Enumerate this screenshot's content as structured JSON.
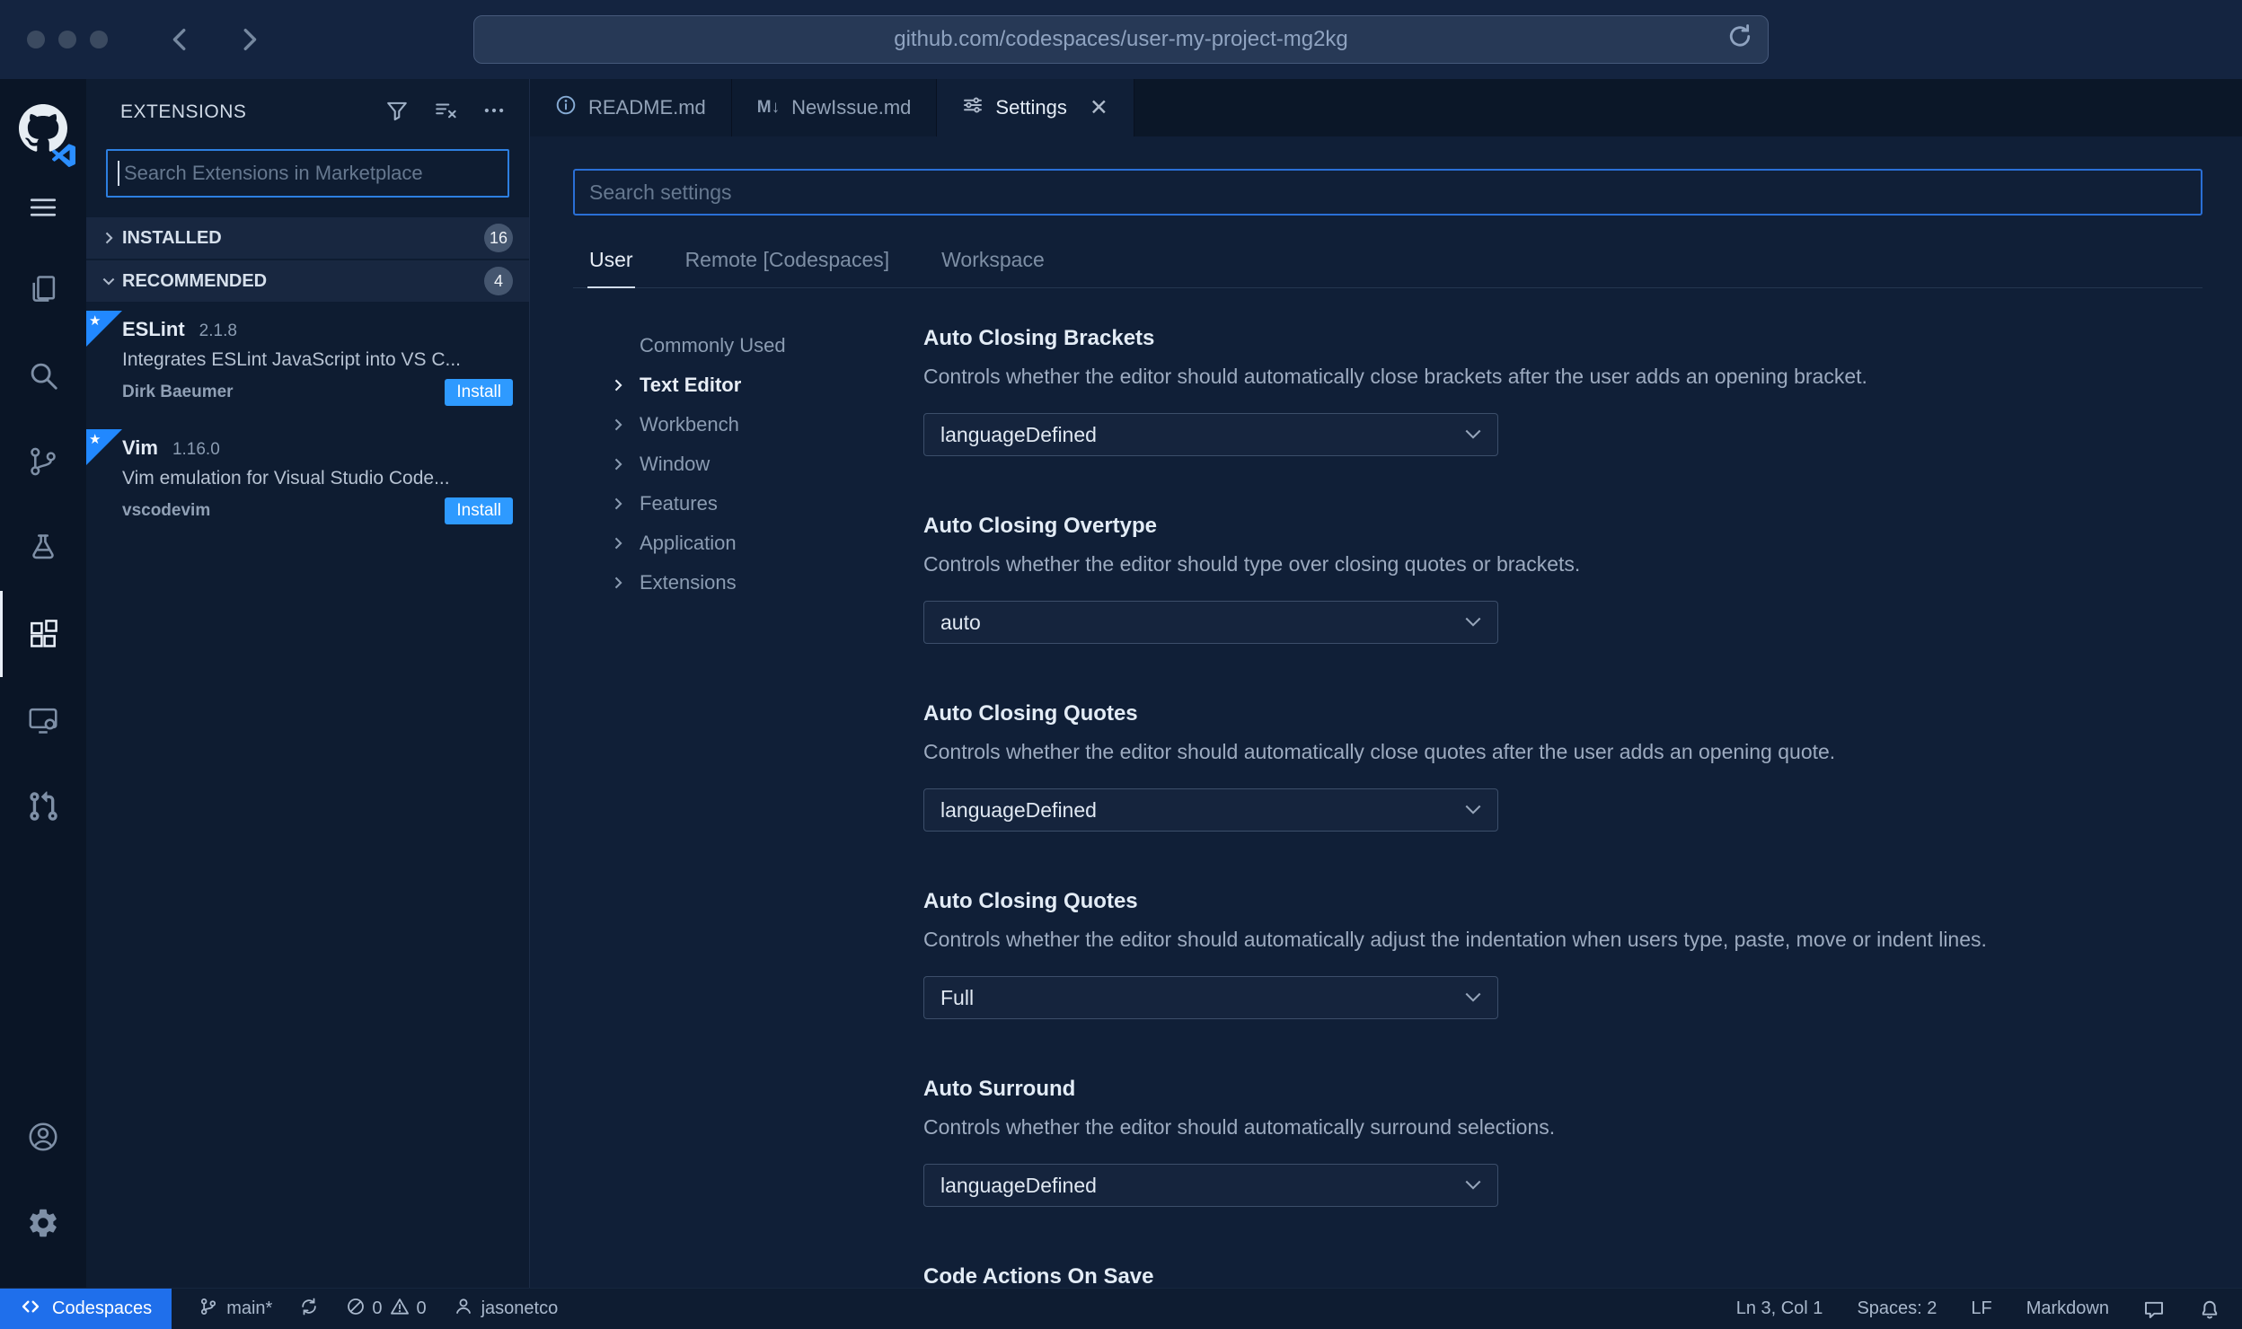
{
  "browser": {
    "url": "github.com/codespaces/user-my-project-mg2kg"
  },
  "icons": {
    "markdown_glyph": "M↓",
    "star": "★",
    "close": "✕"
  },
  "colors": {
    "accent": "#2188ff",
    "install_button": "#2e9aff",
    "codespaces_chip": "#1f6feb",
    "focus_border": "#2d7fe0"
  },
  "sidebar": {
    "title": "EXTENSIONS",
    "search_placeholder": "Search Extensions in Marketplace",
    "sections": {
      "installed": {
        "label": "INSTALLED",
        "badge": "16"
      },
      "recommended": {
        "label": "RECOMMENDED",
        "badge": "4"
      }
    },
    "extensions": [
      {
        "name": "ESLint",
        "version": "2.1.8",
        "description": "Integrates ESLint JavaScript into VS C...",
        "publisher": "Dirk Baeumer",
        "action": "Install"
      },
      {
        "name": "Vim",
        "version": "1.16.0",
        "description": "Vim emulation for Visual Studio Code...",
        "publisher": "vscodevim",
        "action": "Install"
      }
    ]
  },
  "tabs": [
    {
      "label": "README.md"
    },
    {
      "label": "NewIssue.md"
    },
    {
      "label": "Settings"
    }
  ],
  "settings_editor": {
    "search_placeholder": "Search settings",
    "scopes": [
      {
        "label": "User"
      },
      {
        "label": "Remote [Codespaces]"
      },
      {
        "label": "Workspace"
      }
    ],
    "toc": [
      {
        "label": "Commonly Used"
      },
      {
        "label": "Text Editor"
      },
      {
        "label": "Workbench"
      },
      {
        "label": "Window"
      },
      {
        "label": "Features"
      },
      {
        "label": "Application"
      },
      {
        "label": "Extensions"
      }
    ],
    "items": [
      {
        "title": "Auto Closing Brackets",
        "description": "Controls whether the editor should automatically close brackets after the user adds an opening bracket.",
        "value": "languageDefined"
      },
      {
        "title": "Auto Closing Overtype",
        "description": "Controls whether the editor should type over closing quotes or brackets.",
        "value": "auto"
      },
      {
        "title": "Auto Closing Quotes",
        "description": "Controls whether the editor should automatically close quotes after the user adds an opening quote.",
        "value": "languageDefined"
      },
      {
        "title": "Auto Closing Quotes",
        "description": "Controls whether the editor should automatically adjust the indentation when users type, paste, move or indent lines.",
        "value": "Full"
      },
      {
        "title": "Auto Surround",
        "description": "Controls whether the editor should automatically surround selections.",
        "value": "languageDefined"
      },
      {
        "title": "Code Actions On Save",
        "description": "",
        "value": ""
      }
    ]
  },
  "status_bar": {
    "codespaces": "Codespaces",
    "branch": "main*",
    "errors": "0",
    "warnings": "0",
    "user": "jasonetco",
    "line_col": "Ln 3, Col 1",
    "spaces": "Spaces: 2",
    "eol": "LF",
    "language": "Markdown"
  }
}
